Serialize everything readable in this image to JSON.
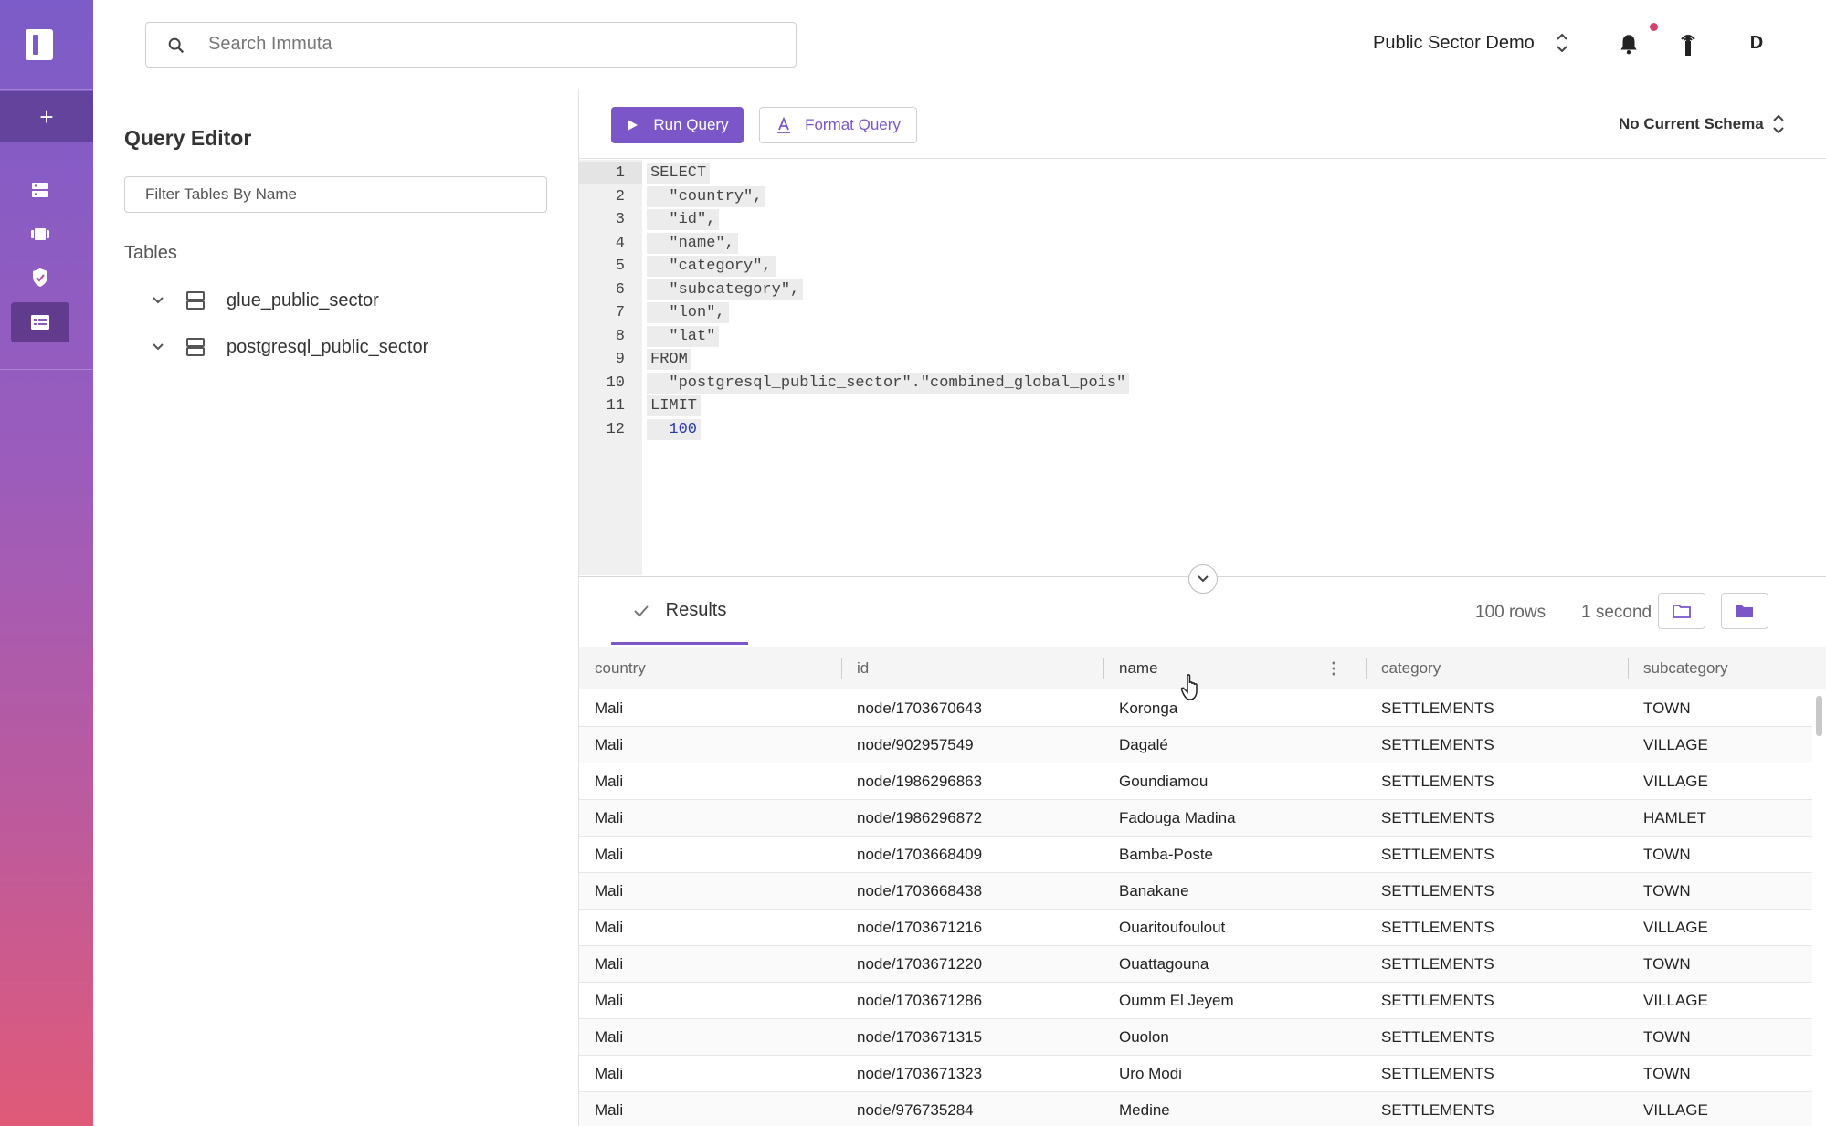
{
  "topbar": {
    "search_placeholder": "Search Immuta",
    "project_name": "Public Sector Demo",
    "avatar_initial": "D"
  },
  "left_panel": {
    "title": "Query Editor",
    "filter_placeholder": "Filter Tables By Name",
    "tables_label": "Tables",
    "tables": [
      {
        "name": "glue_public_sector"
      },
      {
        "name": "postgresql_public_sector"
      }
    ]
  },
  "toolbar": {
    "run_label": "Run Query",
    "format_label": "Format Query",
    "schema_label": "No Current Schema"
  },
  "editor": {
    "lines": [
      {
        "n": "1",
        "text": "SELECT",
        "type": "kw"
      },
      {
        "n": "2",
        "text": "  \"country\",",
        "type": "str"
      },
      {
        "n": "3",
        "text": "  \"id\",",
        "type": "str"
      },
      {
        "n": "4",
        "text": "  \"name\",",
        "type": "str"
      },
      {
        "n": "5",
        "text": "  \"category\",",
        "type": "str"
      },
      {
        "n": "6",
        "text": "  \"subcategory\",",
        "type": "str"
      },
      {
        "n": "7",
        "text": "  \"lon\",",
        "type": "str"
      },
      {
        "n": "8",
        "text": "  \"lat\"",
        "type": "str"
      },
      {
        "n": "9",
        "text": "FROM",
        "type": "kw"
      },
      {
        "n": "10",
        "text": "  \"postgresql_public_sector\".\"combined_global_pois\"",
        "type": "str"
      },
      {
        "n": "11",
        "text": "LIMIT",
        "type": "kw"
      },
      {
        "n": "12",
        "text": "  100",
        "type": "num"
      }
    ]
  },
  "results": {
    "tab_label": "Results",
    "rows_count": "100 rows",
    "duration": "1 second",
    "columns": [
      "country",
      "id",
      "name",
      "category",
      "subcategory"
    ],
    "rows": [
      [
        "Mali",
        "node/1703670643",
        "Koronga",
        "SETTLEMENTS",
        "TOWN"
      ],
      [
        "Mali",
        "node/902957549",
        "Dagalé",
        "SETTLEMENTS",
        "VILLAGE"
      ],
      [
        "Mali",
        "node/1986296863",
        "Goundiamou",
        "SETTLEMENTS",
        "VILLAGE"
      ],
      [
        "Mali",
        "node/1986296872",
        "Fadouga Madina",
        "SETTLEMENTS",
        "HAMLET"
      ],
      [
        "Mali",
        "node/1703668409",
        "Bamba-Poste",
        "SETTLEMENTS",
        "TOWN"
      ],
      [
        "Mali",
        "node/1703668438",
        "Banakane",
        "SETTLEMENTS",
        "TOWN"
      ],
      [
        "Mali",
        "node/1703671216",
        "Ouaritoufoulout",
        "SETTLEMENTS",
        "VILLAGE"
      ],
      [
        "Mali",
        "node/1703671220",
        "Ouattagouna",
        "SETTLEMENTS",
        "TOWN"
      ],
      [
        "Mali",
        "node/1703671286",
        "Oumm El Jeyem",
        "SETTLEMENTS",
        "VILLAGE"
      ],
      [
        "Mali",
        "node/1703671315",
        "Ouolon",
        "SETTLEMENTS",
        "TOWN"
      ],
      [
        "Mali",
        "node/1703671323",
        "Uro Modi",
        "SETTLEMENTS",
        "TOWN"
      ],
      [
        "Mali",
        "node/976735284",
        "Medine",
        "SETTLEMENTS",
        "VILLAGE"
      ]
    ]
  },
  "colors": {
    "accent": "#7a56c8",
    "notification_dot": "#d84070"
  }
}
